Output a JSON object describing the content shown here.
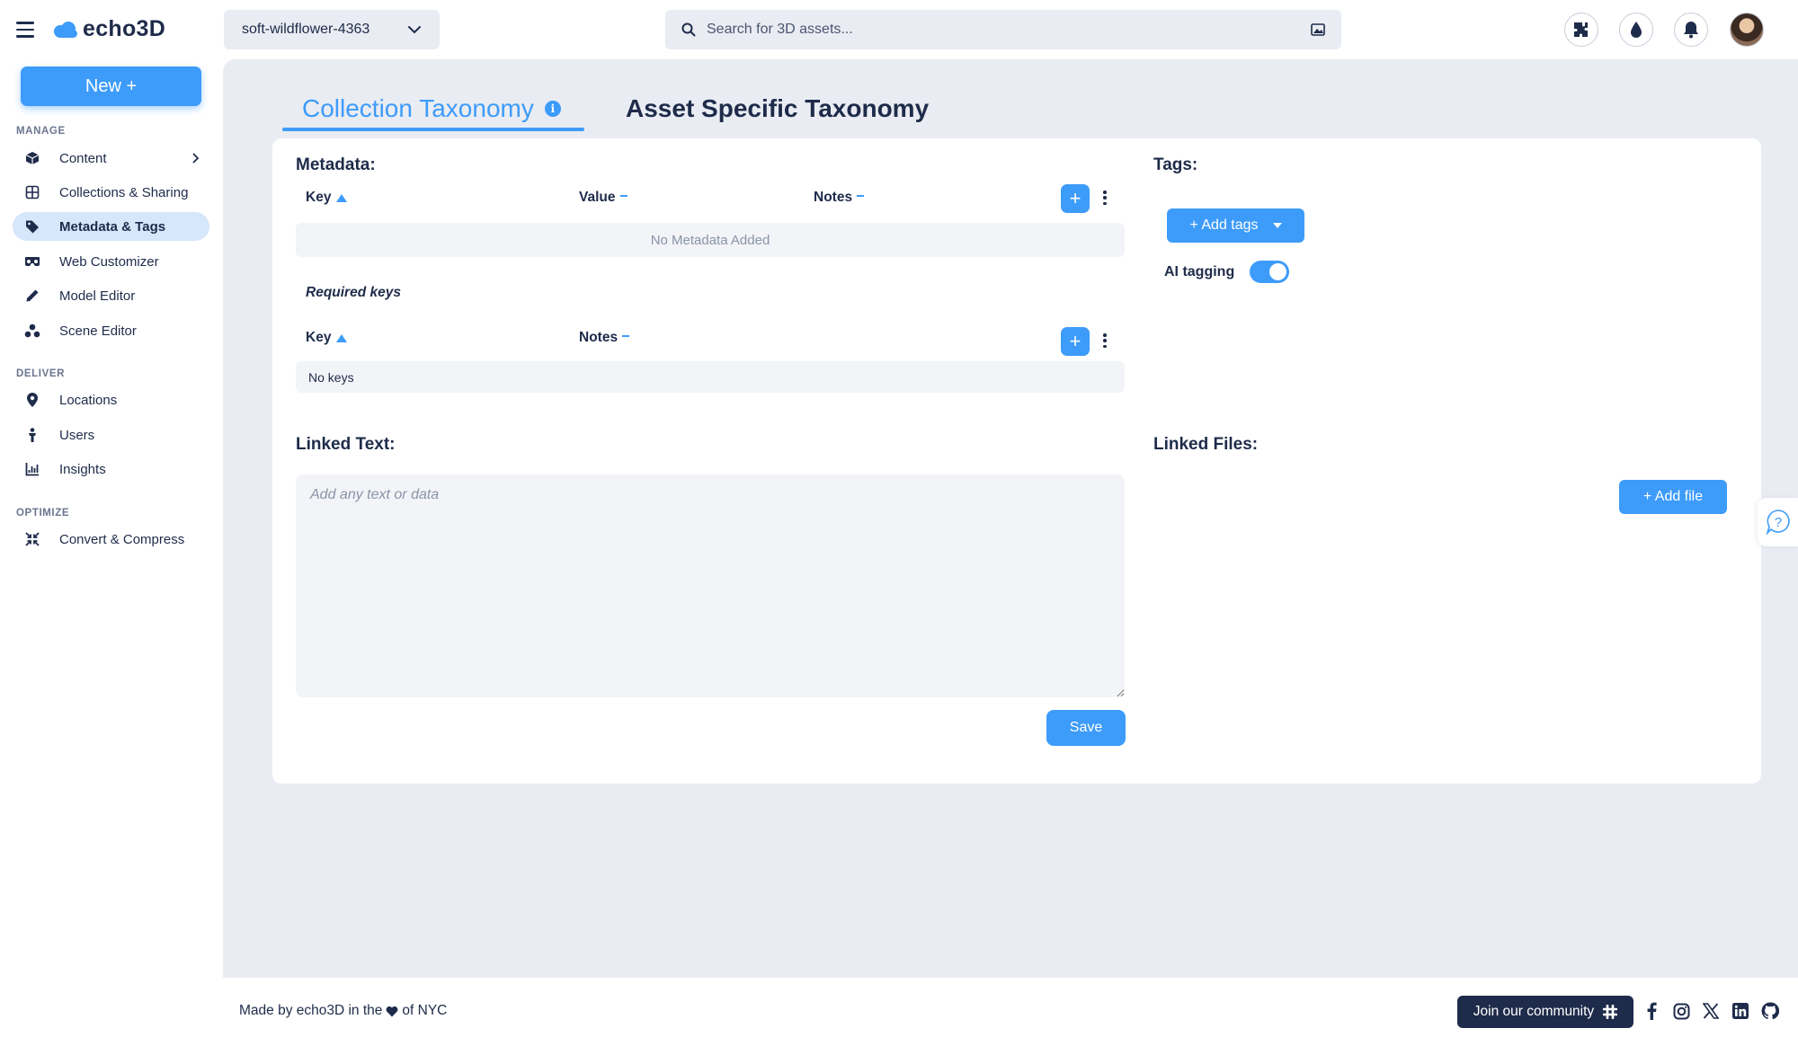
{
  "brand": {
    "name": "echo3D",
    "accent": "#3d9bfa",
    "navy": "#1e2b4a"
  },
  "project_select": {
    "value": "soft-wildflower-4363"
  },
  "search": {
    "placeholder": "Search for 3D assets..."
  },
  "sidebar": {
    "new_button": "New +",
    "sections": {
      "manage": "MANAGE",
      "deliver": "DELIVER",
      "optimize": "OPTIMIZE"
    },
    "items": [
      {
        "label": "Content",
        "icon": "cube-icon"
      },
      {
        "label": "Collections & Sharing",
        "icon": "grid-icon"
      },
      {
        "label": "Metadata & Tags",
        "icon": "tag-icon",
        "active": true
      },
      {
        "label": "Web Customizer",
        "icon": "vr-goggles-icon"
      },
      {
        "label": "Model Editor",
        "icon": "pencil-icon"
      },
      {
        "label": "Scene Editor",
        "icon": "shapes-icon"
      },
      {
        "label": "Locations",
        "icon": "map-pin-icon"
      },
      {
        "label": "Users",
        "icon": "person-icon"
      },
      {
        "label": "Insights",
        "icon": "chart-icon"
      },
      {
        "label": "Convert & Compress",
        "icon": "compress-icon"
      }
    ]
  },
  "tabs": [
    {
      "label": "Collection Taxonomy",
      "active": true
    },
    {
      "label": "Asset Specific Taxonomy",
      "active": false
    }
  ],
  "metadata": {
    "title": "Metadata:",
    "columns": [
      "Key",
      "Value",
      "Notes"
    ],
    "empty_text": "No Metadata Added"
  },
  "required_keys": {
    "title": "Required keys",
    "columns": [
      "Key",
      "Notes"
    ],
    "empty_text": "No keys"
  },
  "tags": {
    "title": "Tags:",
    "add_button": "+ Add tags",
    "ai_tagging_label": "AI tagging",
    "ai_tagging_on": true
  },
  "linked_text": {
    "title": "Linked Text:",
    "placeholder": "Add any text or data",
    "save_button": "Save"
  },
  "linked_files": {
    "title": "Linked Files:",
    "add_button": "+ Add file"
  },
  "footer": {
    "made_by_prefix": "Made by echo3D in the",
    "made_by_suffix": "of NYC",
    "community_button": "Join our community",
    "socials": [
      "facebook-icon",
      "instagram-icon",
      "x-icon",
      "linkedin-icon",
      "github-icon"
    ]
  }
}
